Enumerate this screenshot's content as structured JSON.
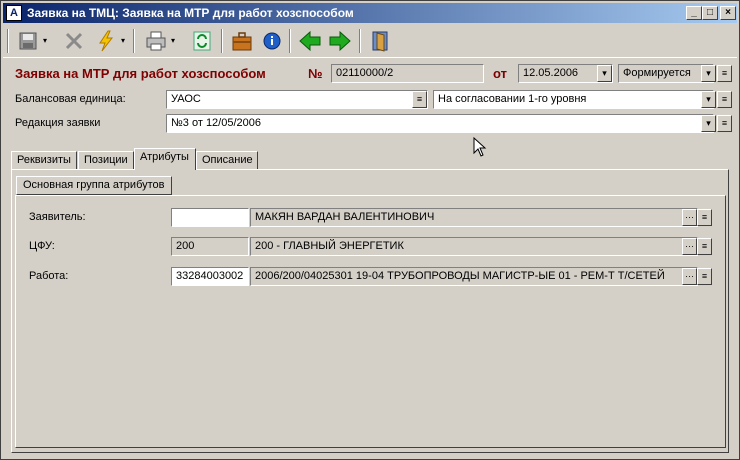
{
  "window": {
    "title": "Заявка на ТМЦ: Заявка на МТР для работ хозспособом",
    "app_icon_glyph": "A",
    "minimize_glyph": "_",
    "maximize_glyph": "□",
    "close_glyph": "×"
  },
  "toolbar": {
    "icons": [
      "save-icon",
      "delete-icon",
      "lightning-icon",
      "print-icon",
      "refresh-icon",
      "briefcase-icon",
      "info-icon",
      "arrow-left-icon",
      "arrow-right-icon",
      "exit-door-icon"
    ],
    "dropdown_glyph": "▾"
  },
  "header": {
    "doc_title": "Заявка на МТР для работ хозспособом",
    "number_label": "№",
    "number_value": "02110000/2",
    "date_label": "от",
    "date_value": "12.05.2006",
    "status_value": "Формируется"
  },
  "form": {
    "balance_label": "Балансовая единица:",
    "balance_value": "УАОС",
    "approval_value": "На согласовании 1-го уровня",
    "edition_label": "Редакция заявки",
    "edition_value": "№3 от 12/05/2006"
  },
  "tabs": [
    {
      "label": "Реквизиты"
    },
    {
      "label": "Позиции"
    },
    {
      "label": "Атрибуты"
    },
    {
      "label": "Описание"
    }
  ],
  "attributes": {
    "group_tab": "Основная группа атрибутов",
    "applicant_label": "Заявитель:",
    "applicant_code": "",
    "applicant_name": "МАКЯН ВАРДАН ВАЛЕНТИНОВИЧ",
    "cfu_label": "ЦФУ:",
    "cfu_code": "200",
    "cfu_name": "200 - ГЛАВНЫЙ ЭНЕРГЕТИК",
    "work_label": "Работа:",
    "work_code": "33284003002",
    "work_name": "2006/200/04025301 19-04 ТРУБОПРОВОДЫ МАГИСТР-ЫЕ 01 - РЕМ-Т Т/СЕТЕЙ"
  },
  "glyphs": {
    "ellipsis": "···",
    "menu": "≡",
    "down": "▾"
  },
  "colors": {
    "title_gradient_start": "#0a246a",
    "title_gradient_end": "#a6caf0",
    "doc_title_red": "#7f0000",
    "window_bg": "#d4d0c8"
  }
}
